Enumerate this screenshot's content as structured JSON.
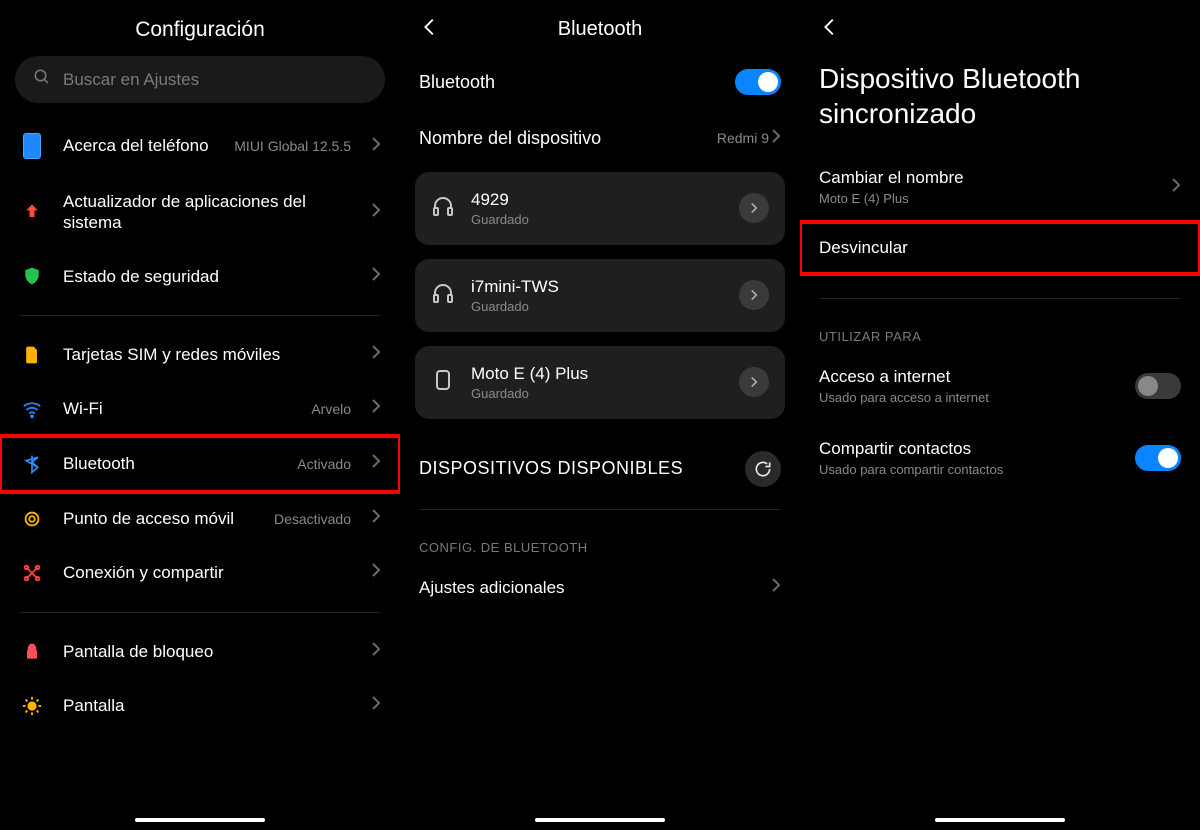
{
  "p1": {
    "title": "Configuración",
    "search_placeholder": "Buscar en Ajustes",
    "rows": {
      "about": {
        "label": "Acerca del teléfono",
        "value": "MIUI Global 12.5.5"
      },
      "updater": {
        "label": "Actualizador de aplicaciones del sistema"
      },
      "security": {
        "label": "Estado de seguridad"
      },
      "sim": {
        "label": "Tarjetas SIM y redes móviles"
      },
      "wifi": {
        "label": "Wi-Fi",
        "value": "Arvelo"
      },
      "bluetooth": {
        "label": "Bluetooth",
        "value": "Activado"
      },
      "hotspot": {
        "label": "Punto de acceso móvil",
        "value": "Desactivado"
      },
      "share": {
        "label": "Conexión y compartir"
      },
      "lockscreen": {
        "label": "Pantalla de bloqueo"
      },
      "display": {
        "label": "Pantalla"
      }
    }
  },
  "p2": {
    "title": "Bluetooth",
    "bt_label": "Bluetooth",
    "device_name_label": "Nombre del dispositivo",
    "device_name_value": "Redmi 9",
    "devices": [
      {
        "name": "4929",
        "sub": "Guardado",
        "type": "headphones"
      },
      {
        "name": "i7mini-TWS",
        "sub": "Guardado",
        "type": "headphones"
      },
      {
        "name": "Moto E (4) Plus",
        "sub": "Guardado",
        "type": "phone"
      }
    ],
    "available_header": "DISPOSITIVOS DISPONIBLES",
    "config_header": "CONFIG. DE BLUETOOTH",
    "extra_settings": "Ajustes adicionales"
  },
  "p3": {
    "big_title_l1": "Dispositivo Bluetooth",
    "big_title_l2": "sincronizado",
    "rename_label": "Cambiar el nombre",
    "rename_value": "Moto E (4) Plus",
    "unpair": "Desvincular",
    "use_for": "UTILIZAR PARA",
    "internet_label": "Acceso a internet",
    "internet_sub": "Usado para acceso a internet",
    "contacts_label": "Compartir contactos",
    "contacts_sub": "Usado para compartir contactos"
  }
}
